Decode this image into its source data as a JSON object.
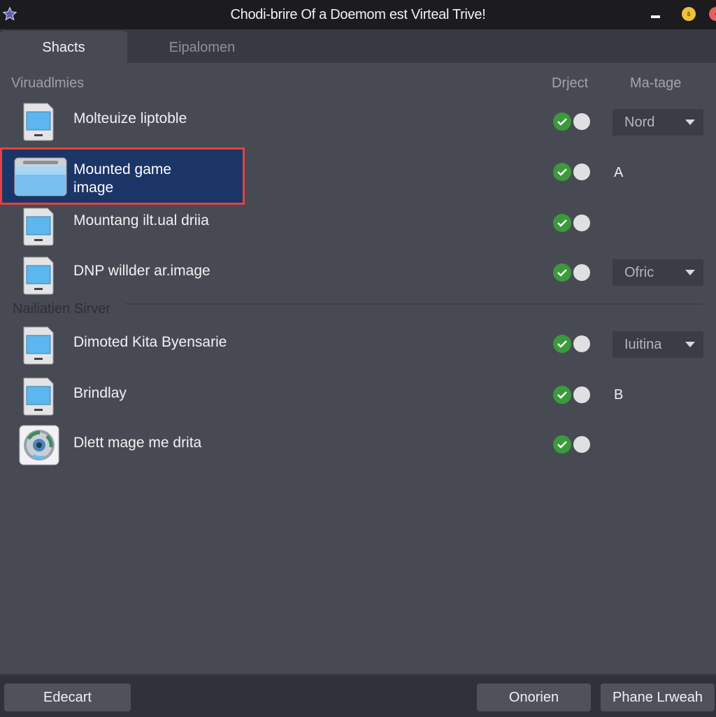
{
  "window": {
    "title": "Chodi-brire Of a Doemom est Virteal Trive!",
    "app_icon": "star-icon",
    "controls": {
      "minimize": "minimize-icon",
      "maximize_glyph": "š",
      "close_glyph": "•"
    }
  },
  "tabs": [
    {
      "label": "Shacts",
      "active": true
    },
    {
      "label": "Eipalomen",
      "active": false
    }
  ],
  "columns": {
    "object": "Drject",
    "mountage": "Ma-tage"
  },
  "sections": [
    {
      "label": "Viruadlmies"
    },
    {
      "label": "Nailiatien Sirver"
    }
  ],
  "rows": [
    {
      "label": "Molteuize liptoble",
      "icon": "virtual-drive-icon",
      "status_ok": true,
      "mount_dropdown": "Nord",
      "mount_letter": null
    },
    {
      "label_line1": "Mounted game",
      "label_line2": "image",
      "icon": "folder-drive-icon",
      "status_ok": true,
      "mount_dropdown": null,
      "mount_letter": "A",
      "selected": true
    },
    {
      "label": "Mountang ilt.ual driia",
      "icon": "virtual-drive-icon",
      "status_ok": true,
      "mount_dropdown": null,
      "mount_letter": null
    },
    {
      "label": "DNP willder ar.image",
      "icon": "virtual-drive-icon",
      "status_ok": true,
      "mount_dropdown": "Ofric",
      "mount_letter": null
    },
    {
      "label": "Dimoted Kita Byensarie",
      "icon": "virtual-drive-icon",
      "status_ok": true,
      "mount_dropdown": "Iuitina",
      "mount_letter": null
    },
    {
      "label": "Brindlay",
      "icon": "virtual-drive-icon",
      "status_ok": true,
      "mount_dropdown": null,
      "mount_letter": "B"
    },
    {
      "label": "Dlett mage me drita",
      "icon": "disc-image-icon",
      "status_ok": true,
      "mount_dropdown": null,
      "mount_letter": null
    }
  ],
  "footer": {
    "left_button": "Edecart",
    "middle_button": "Onorien",
    "right_button": "Phane Lrweah"
  },
  "colors": {
    "selection_bg": "#1b3567",
    "selection_border": "#e2423e",
    "status_green": "#3b9a3b",
    "panel_bg": "#474a53"
  }
}
